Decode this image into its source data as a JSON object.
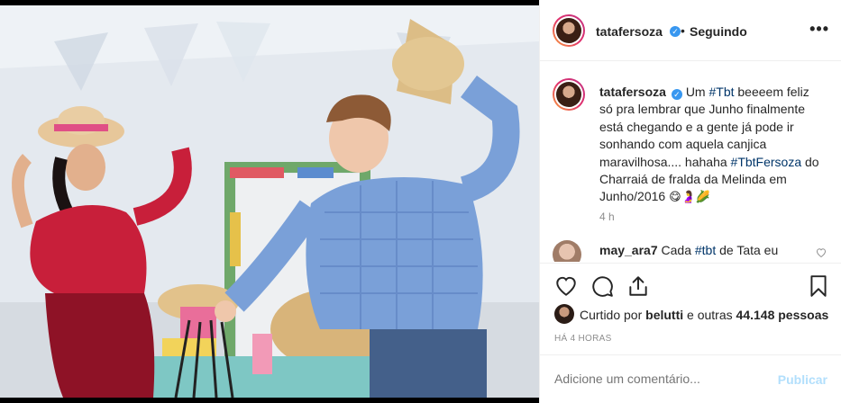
{
  "post": {
    "header": {
      "username": "tatafersoza",
      "verified_glyph": "✓",
      "separator": "•",
      "follow_status": "Seguindo",
      "more_glyph": "•••"
    },
    "caption": {
      "username": "tatafersoza",
      "part1": "Um ",
      "tag1": "#Tbt",
      "part2": " beeeem feliz só pra lembrar que Junho finalmente está chegando e a gente já pode ir sonhando com aquela canjica maravilhosa.... hahaha ",
      "tag2": "#TbtFersoza",
      "part3": " do Charraiá de fralda da Melinda em Junho/2016 ",
      "emojis": "😋🤰🌽"
    },
    "caption_time": "4 h",
    "comment": {
      "username": "may_ara7",
      "part1": "Cada ",
      "tag": "#tbt",
      "part2": " de Tata eu"
    },
    "likes": {
      "prefix": "Curtido por ",
      "user": "belutti",
      "middle": " e outras ",
      "count": "44.148 pessoas"
    },
    "timestamp": "HÁ 4 HORAS",
    "add_comment": {
      "placeholder": "Adicione um comentário...",
      "submit_label": "Publicar"
    },
    "colors": {
      "link": "#003569",
      "verified": "#3897f0",
      "muted": "#8e8e8e",
      "publish_disabled": "#b2dffc"
    },
    "icons": [
      "heart-icon",
      "comment-icon",
      "share-icon",
      "bookmark-icon",
      "more-icon",
      "verified-badge-icon"
    ]
  }
}
